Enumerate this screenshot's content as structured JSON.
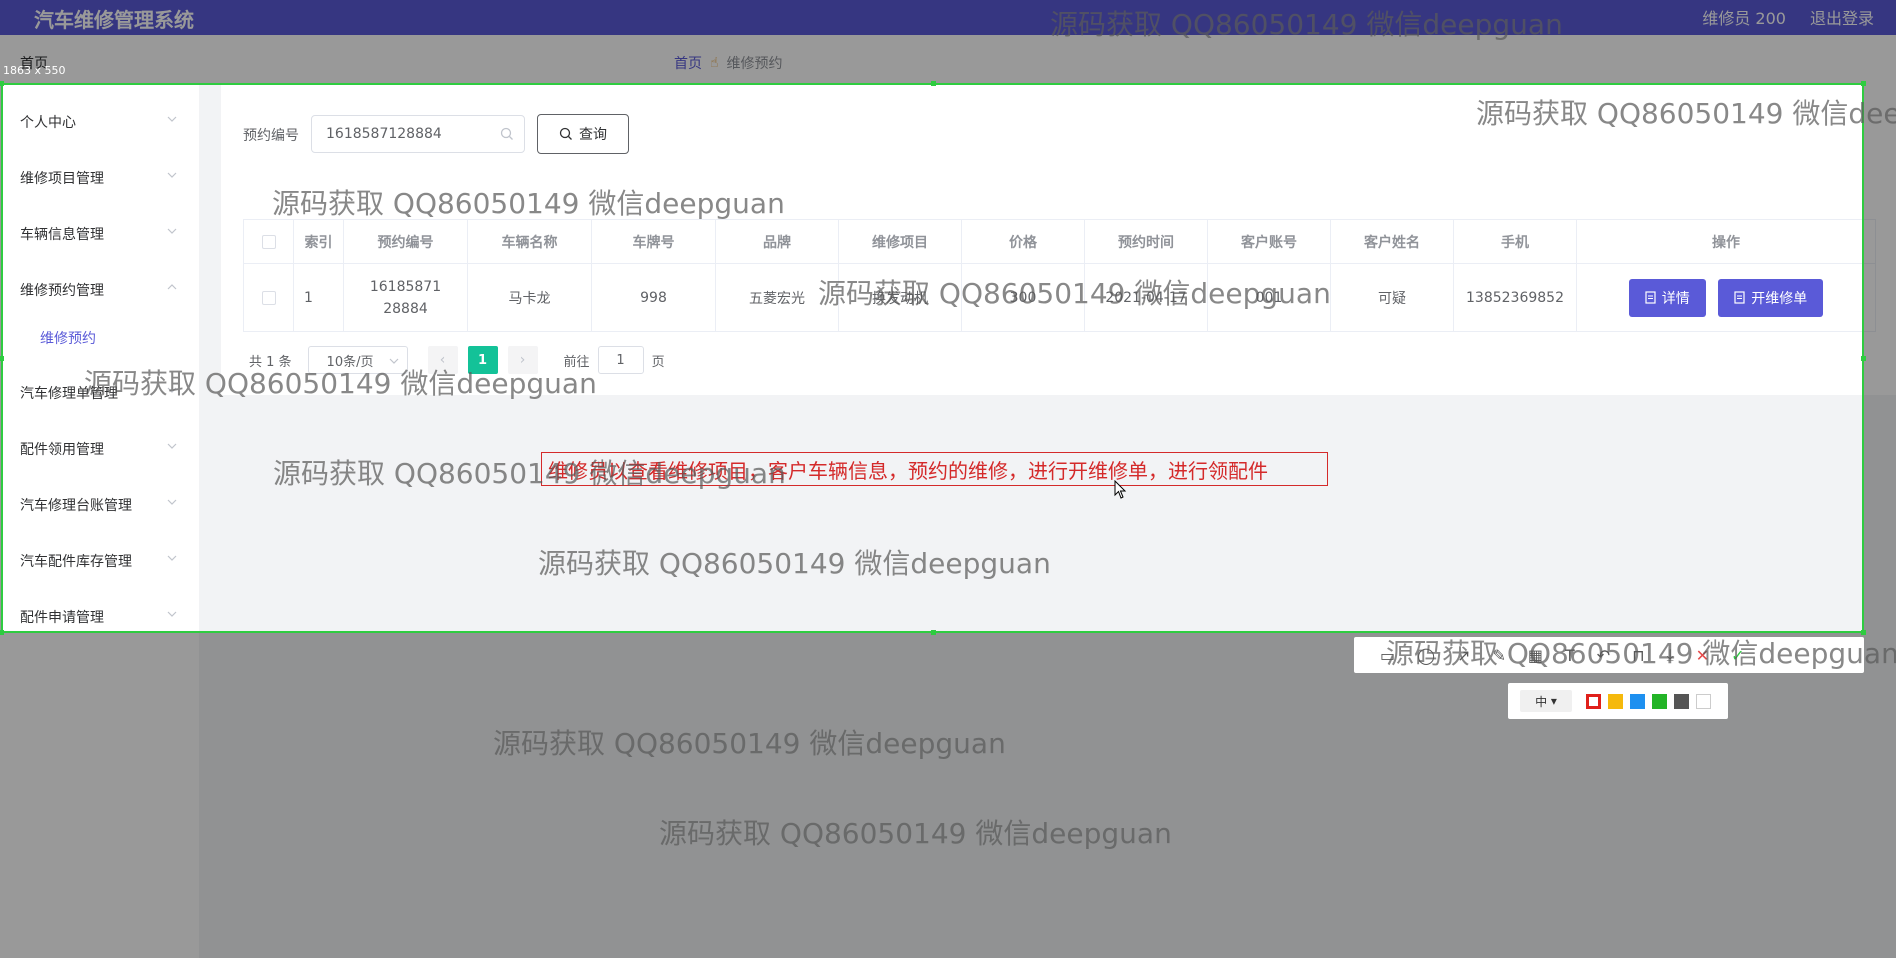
{
  "app": {
    "title": "汽车维修管理系统",
    "user": "维修员 200",
    "logout": "退出登录"
  },
  "nav": {
    "home_tab": "首页",
    "breadcrumb_home": "首页",
    "breadcrumb_current": "维修预约"
  },
  "sidebar": {
    "items": [
      {
        "label": "个人中心",
        "expanded": false
      },
      {
        "label": "维修项目管理",
        "expanded": false
      },
      {
        "label": "车辆信息管理",
        "expanded": false
      },
      {
        "label": "维修预约管理",
        "expanded": true
      },
      {
        "label": "汽车修理单管理",
        "expanded": false
      },
      {
        "label": "配件领用管理",
        "expanded": false
      },
      {
        "label": "汽车修理台账管理",
        "expanded": false
      },
      {
        "label": "汽车配件库存管理",
        "expanded": false
      },
      {
        "label": "配件申请管理",
        "expanded": false
      }
    ],
    "subitem": "维修预约"
  },
  "search": {
    "label": "预约编号",
    "value": "1618587128884",
    "button": "查询"
  },
  "table": {
    "headers": [
      "索引",
      "预约编号",
      "车辆名称",
      "车牌号",
      "品牌",
      "维修项目",
      "价格",
      "预约时间",
      "客户账号",
      "客户姓名",
      "手机",
      "操作"
    ],
    "rows": [
      {
        "index": "1",
        "booking_no": "1618587128884",
        "vehicle": "马卡龙",
        "plate": "998",
        "brand": "五菱宏光",
        "project": "换发动机",
        "price": "300",
        "time": "2021-04-17",
        "account": "001",
        "name": "可疑",
        "phone": "13852369852"
      }
    ],
    "detail_button": "详情",
    "repair_button": "开维修单"
  },
  "pagination": {
    "total": "共 1 条",
    "page_size": "10条/页",
    "current_page": "1",
    "goto": "前往",
    "goto_value": "1",
    "unit": "页"
  },
  "screenshot_tool": {
    "size_label": "1863 x 550",
    "annotation": "维修员以查看维修项目，客户车辆信息，预约的维修，进行开维修单，进行领配件",
    "pen_size": "中",
    "palette": [
      "#e0201b",
      "#f5b90c",
      "#1e90f0",
      "#23b427",
      "#555555",
      "#ffffff"
    ]
  },
  "watermark": "源码获取 QQ86050149 微信deepguan"
}
